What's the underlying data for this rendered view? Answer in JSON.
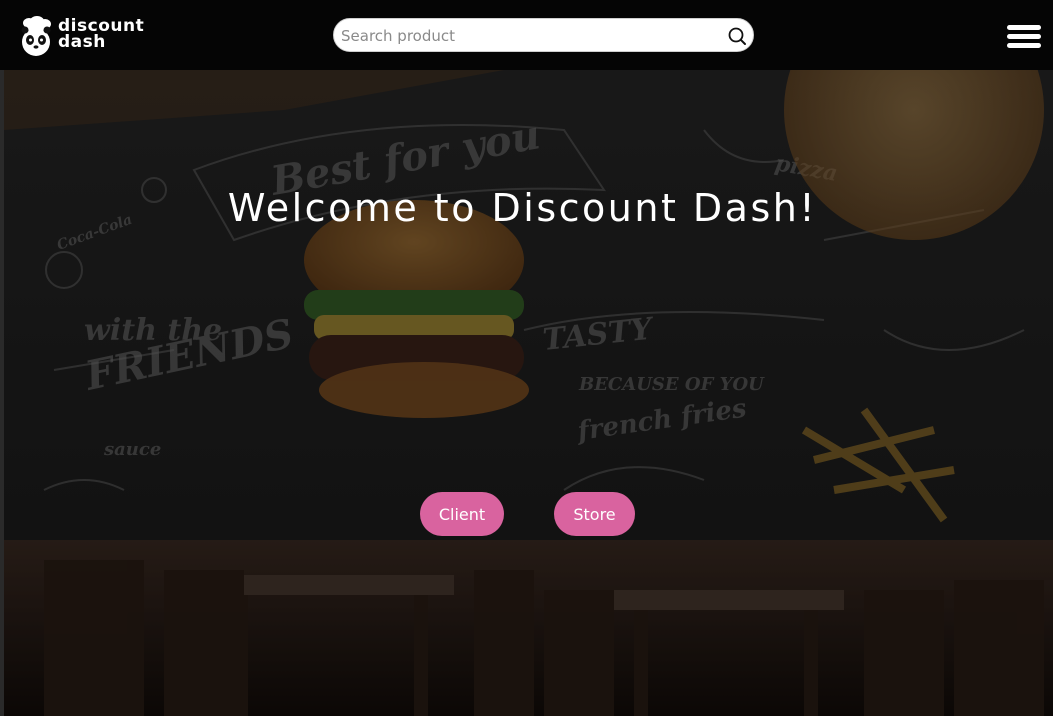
{
  "header": {
    "logo": {
      "line1": "discount",
      "line2": "dash",
      "icon": "panda-chef-icon"
    },
    "search": {
      "placeholder": "Search product",
      "value": "",
      "icon": "search-icon"
    },
    "menu": {
      "icon": "hamburger-menu-icon"
    }
  },
  "hero": {
    "title": "Welcome to Discount Dash!",
    "background": "restaurant-chalkboard-image",
    "buttons": {
      "client": "Client",
      "store": "Store"
    }
  },
  "colors": {
    "navbar": "#050505",
    "button": "#d9639f",
    "text": "#ffffff"
  }
}
